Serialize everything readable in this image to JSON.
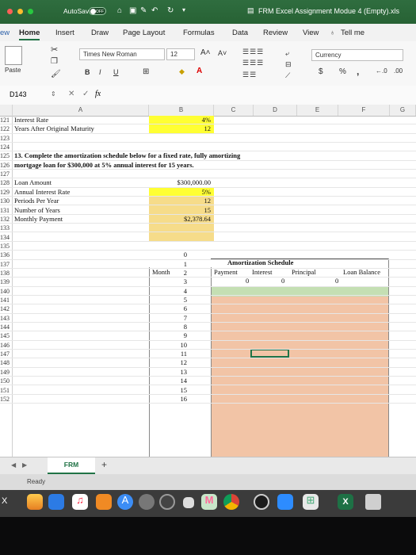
{
  "titlebar": {
    "autosave_label": "AutoSave",
    "autosave_state": "OFF",
    "document_title": "FRM Excel Assignment Modue 4 (Empty).xls",
    "colors": {
      "bar": "#2b6a3a"
    }
  },
  "tabs": {
    "cut_prefix": "ew",
    "items": [
      "Home",
      "Insert",
      "Draw",
      "Page Layout",
      "Formulas",
      "Data",
      "Review",
      "View"
    ],
    "tell_me": "Tell me"
  },
  "ribbon": {
    "paste_label": "Paste",
    "font_name": "Times New Roman",
    "font_size": "12",
    "bold": "B",
    "italic": "I",
    "underline": "U",
    "number_format": "Currency",
    "currency_symbol": "$",
    "percent_symbol": "%",
    "comma_symbol": ",",
    "inc_decimal": "+.0\n.00",
    "dec_decimal": ".00\n→.0"
  },
  "formula_bar": {
    "name_box": "D143",
    "fx": "fx",
    "value": ""
  },
  "columns": [
    "A",
    "B",
    "C",
    "D",
    "E",
    "F",
    "G"
  ],
  "rows": [
    {
      "n": "121",
      "a": "Interest Rate",
      "b": "4%"
    },
    {
      "n": "122",
      "a": "Years After Original Maturity",
      "b": "12"
    },
    {
      "n": "123"
    },
    {
      "n": "124"
    },
    {
      "n": "125",
      "a": "13.  Complete the amortization schedule below for a fixed rate, fully amortizing"
    },
    {
      "n": "126",
      "a": "mortgage loan for $300,000 at 5% annual interest for 15 years."
    },
    {
      "n": "127"
    },
    {
      "n": "128",
      "a": "Loan Amount",
      "b": "$300,000.00"
    },
    {
      "n": "129",
      "a": "Annual Interest Rate",
      "b": "5%"
    },
    {
      "n": "130",
      "a": "Periods Per Year",
      "b": "12"
    },
    {
      "n": "131",
      "a": "Number of Years",
      "b": "15"
    },
    {
      "n": "132",
      "a": "Monthly Payment",
      "b": "$2,378.64"
    },
    {
      "n": "133"
    },
    {
      "n": "134"
    },
    {
      "n": "135"
    },
    {
      "n": "136"
    },
    {
      "n": "137"
    },
    {
      "n": "138"
    },
    {
      "n": "139"
    },
    {
      "n": "140"
    },
    {
      "n": "141"
    },
    {
      "n": "142"
    },
    {
      "n": "143"
    },
    {
      "n": "144"
    },
    {
      "n": "145"
    },
    {
      "n": "146"
    },
    {
      "n": "147"
    },
    {
      "n": "148"
    },
    {
      "n": "149"
    },
    {
      "n": "150"
    },
    {
      "n": "151"
    },
    {
      "n": "152"
    }
  ],
  "schedule": {
    "title": "Amortization Schedule",
    "headers": {
      "month": "Month",
      "payment": "Payment",
      "interest": "Interest",
      "principal": "Principal",
      "balance": "Loan Balance"
    },
    "row0": {
      "payment": "0",
      "interest": "0",
      "principal": "0"
    },
    "months": [
      "0",
      "1",
      "2",
      "3",
      "4",
      "5",
      "6",
      "7",
      "8",
      "9",
      "10",
      "11",
      "12",
      "13",
      "14",
      "15",
      "16"
    ],
    "colors": {
      "highlight": "#ffff33",
      "input": "#f6dc8a",
      "table": "#f2c4a6",
      "first_row": "#c4dfb3"
    }
  },
  "sheet_tabs": {
    "active": "FRM",
    "add": "+"
  },
  "status": {
    "text": "Ready"
  },
  "dock": {
    "icons": [
      "x-icon",
      "chart-icon",
      "keynote-icon",
      "music-icon",
      "books-icon",
      "app-store-icon",
      "system-prefs-icon",
      "screenshot-icon",
      "battery-icon",
      "messages-icon",
      "chrome-icon",
      "photos-icon",
      "zoom-icon",
      "grid-icon",
      "excel-icon",
      "trash-icon"
    ]
  }
}
